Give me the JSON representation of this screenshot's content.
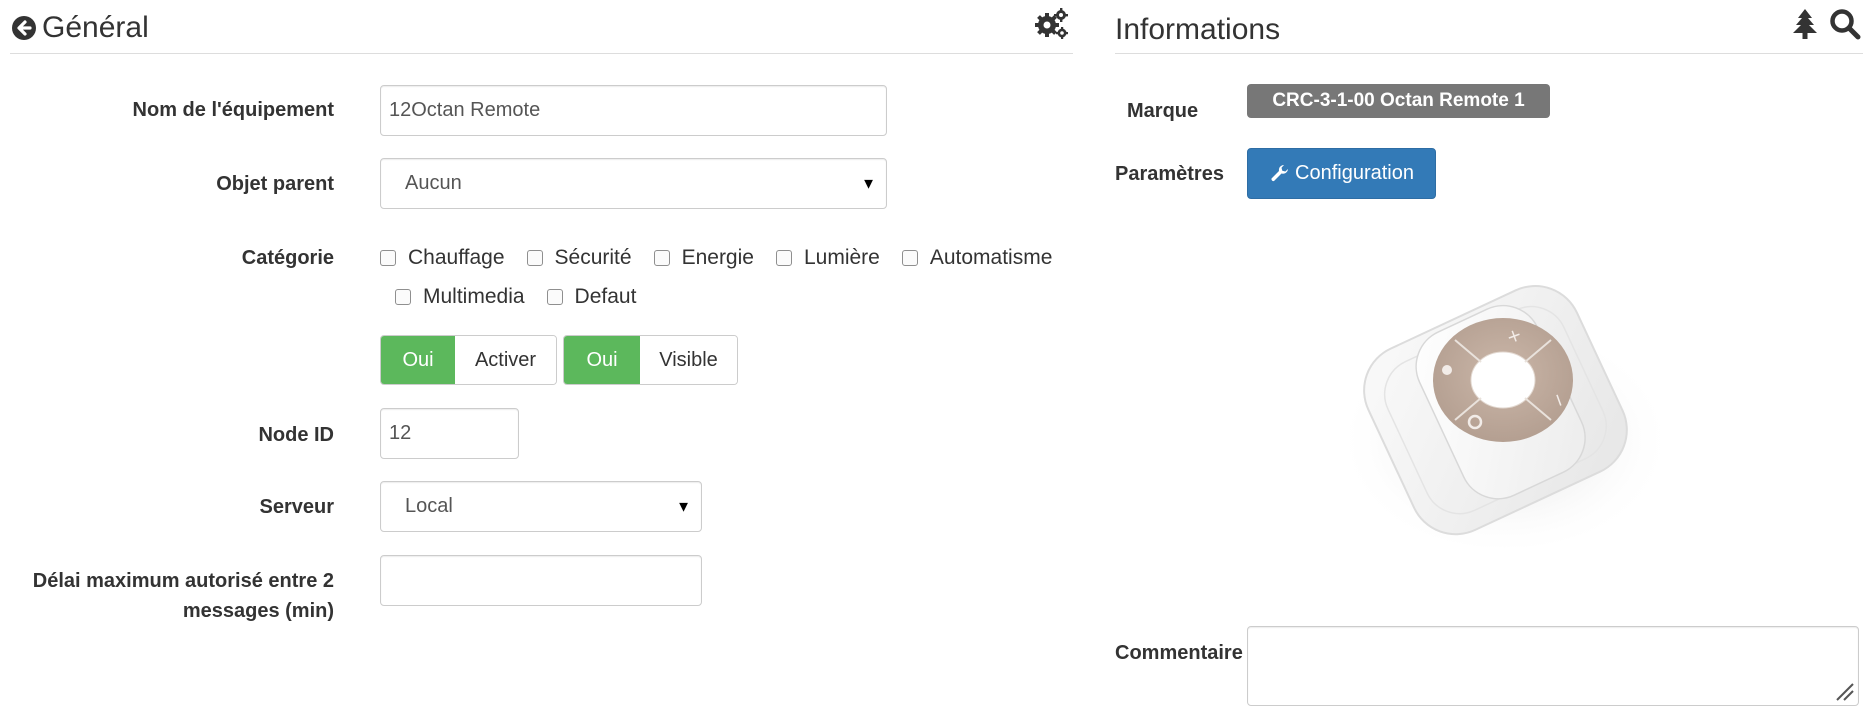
{
  "general": {
    "title": "Général",
    "fields": {
      "name_label": "Nom de l'équipement",
      "name_value": "12Octan Remote",
      "parent_label": "Objet parent",
      "parent_value": "Aucun",
      "category_label": "Catégorie",
      "categories": [
        "Chauffage",
        "Sécurité",
        "Energie",
        "Lumière",
        "Automatisme",
        "Multimedia",
        "Defaut"
      ],
      "toggle_enable": {
        "state": "Oui",
        "label": "Activer"
      },
      "toggle_visible": {
        "state": "Oui",
        "label": "Visible"
      },
      "node_label": "Node ID",
      "node_value": "12",
      "server_label": "Serveur",
      "server_value": "Local",
      "delay_label_line1": "Délai maximum autorisé entre 2",
      "delay_label_line2": "messages (min)",
      "delay_value": ""
    }
  },
  "info": {
    "title": "Informations",
    "brand_label": "Marque",
    "brand_value": "CRC-3-1-00 Octan Remote 1",
    "params_label": "Paramètres",
    "config_button": "Configuration",
    "comment_label": "Commentaire",
    "comment_value": ""
  },
  "icons": [
    "back-arrow-icon",
    "gears-icon",
    "tree-icon",
    "search-icon",
    "wrench-icon",
    "resize-grip-icon"
  ],
  "colors": {
    "success": "#5cb85c",
    "primary": "#337ab7",
    "badge": "#777777"
  }
}
